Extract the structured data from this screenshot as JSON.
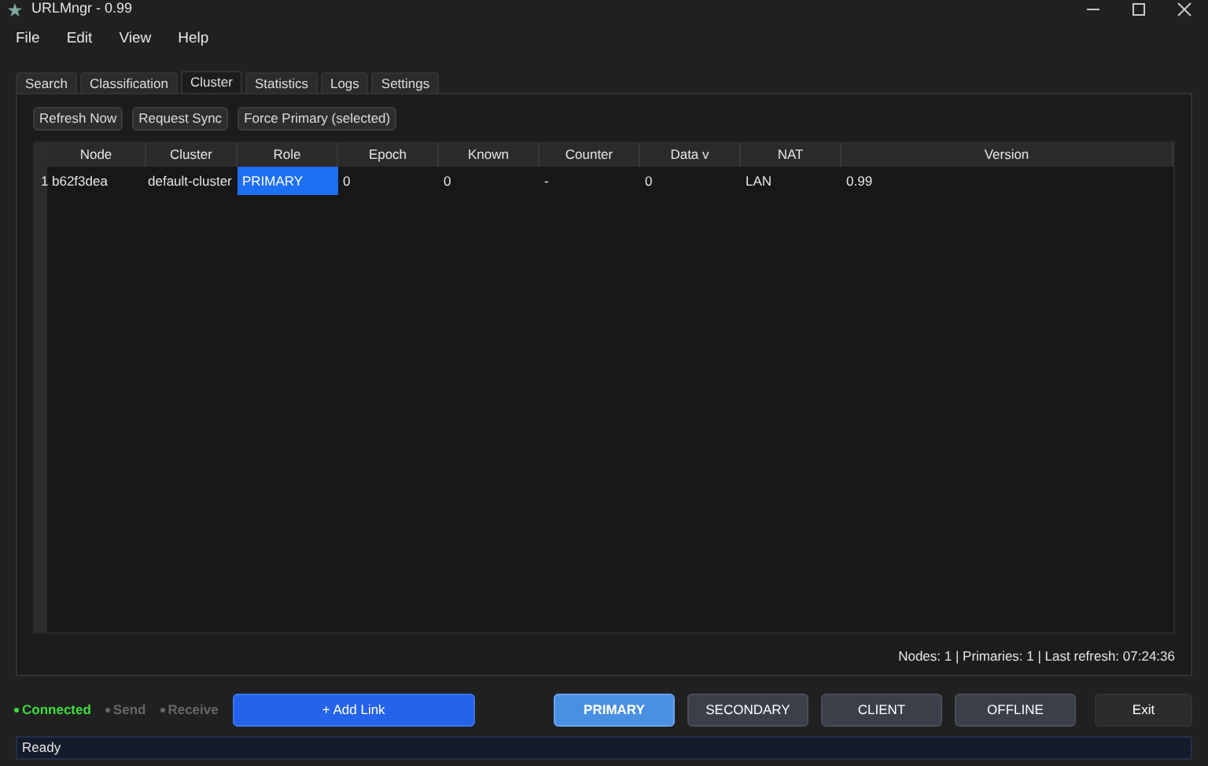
{
  "window": {
    "title": "URLMngr - 0.99"
  },
  "menu": [
    "File",
    "Edit",
    "View",
    "Help"
  ],
  "tabs": [
    {
      "label": "Search",
      "selected": false
    },
    {
      "label": "Classification",
      "selected": false
    },
    {
      "label": "Cluster",
      "selected": true
    },
    {
      "label": "Statistics",
      "selected": false
    },
    {
      "label": "Logs",
      "selected": false
    },
    {
      "label": "Settings",
      "selected": false
    }
  ],
  "toolbar": [
    "Refresh Now",
    "Request Sync",
    "Force Primary (selected)"
  ],
  "table": {
    "columns": [
      "Node",
      "Cluster",
      "Role",
      "Epoch",
      "Known",
      "Counter",
      "Data v",
      "NAT",
      "Version"
    ],
    "rows": [
      {
        "number": "1",
        "selected": true,
        "cells": [
          "b62f3dea",
          "default-cluster",
          "PRIMARY",
          "0",
          "0",
          "-",
          "0",
          "LAN",
          "0.99"
        ]
      }
    ]
  },
  "summary": "Nodes: 1 | Primaries: 1 | Last refresh: 07:24:36",
  "indicators": [
    {
      "label": "Connected",
      "on": true
    },
    {
      "label": "Send",
      "on": false
    },
    {
      "label": "Receive",
      "on": false
    }
  ],
  "add_button": "+ Add Link",
  "modes": [
    {
      "label": "PRIMARY",
      "selected": true
    },
    {
      "label": "SECONDARY",
      "selected": false
    },
    {
      "label": "CLIENT",
      "selected": false
    },
    {
      "label": "OFFLINE",
      "selected": false
    }
  ],
  "exit_button": "Exit",
  "status_bar": "Ready"
}
